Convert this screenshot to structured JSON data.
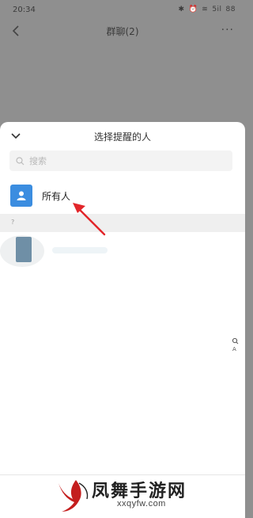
{
  "status_bar": {
    "time": "20:34",
    "icons": [
      "bluetooth-icon",
      "alarm-icon",
      "wifi-icon",
      "signal-icon",
      "battery-icon"
    ],
    "signal_text": "5il",
    "battery_text": "88"
  },
  "nav": {
    "title": "群聊(2)",
    "more_label": "···"
  },
  "sheet": {
    "title": "选择提醒的人",
    "search_placeholder": "搜索",
    "everyone_label": "所有人",
    "section_letter": "?"
  },
  "watermark": {
    "name": "凤舞手游网",
    "url": "xxqyfw.com"
  },
  "colors": {
    "overlay": "#8f8f8f",
    "avatar_blue": "#3b8de0",
    "arrow_red": "#e2262a"
  }
}
